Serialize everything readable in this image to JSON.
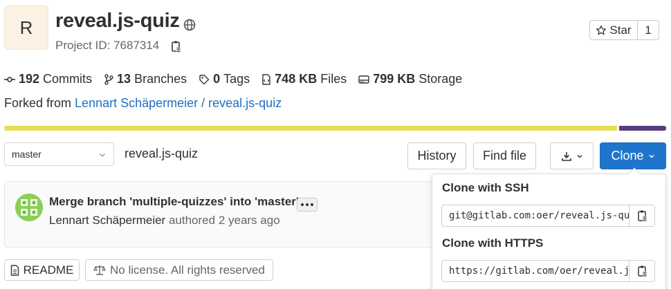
{
  "project": {
    "avatar_letter": "R",
    "title": "reveal.js-quiz",
    "id_text": "Project ID: 7687314",
    "visibility_icon": "globe-icon"
  },
  "star": {
    "label": "Star",
    "count": "1"
  },
  "stats": {
    "commits_count": "192",
    "commits_label": "Commits",
    "branches_count": "13",
    "branches_label": "Branches",
    "tags_count": "0",
    "tags_label": "Tags",
    "files_size": "748 KB",
    "files_label": "Files",
    "storage_size": "799 KB",
    "storage_label": "Storage"
  },
  "fork": {
    "prefix": "Forked from",
    "source": "Lennart Schäpermeier / reveal.js-quiz"
  },
  "language_bar": {
    "colors": [
      "#e7dd57",
      "#563d7c"
    ]
  },
  "repo_nav": {
    "branch": "master",
    "breadcrumb": "reveal.js-quiz",
    "history_label": "History",
    "find_file_label": "Find file",
    "clone_label": "Clone"
  },
  "last_commit": {
    "title": "Merge branch 'multiple-quizzes' into 'master'",
    "author": "Lennart Schäpermeier",
    "action": "authored",
    "time": "2 years ago"
  },
  "badges": {
    "readme_label": "README",
    "license_label": "No license. All rights reserved"
  },
  "clone_dropdown": {
    "ssh_heading": "Clone with SSH",
    "ssh_url": "git@gitlab.com:oer/reveal.js-quiz.git",
    "https_heading": "Clone with HTTPS",
    "https_url": "https://gitlab.com/oer/reveal.js-quiz.git"
  },
  "colors": {
    "link": "#1f6fbf",
    "primary_button": "#1f75cb"
  }
}
